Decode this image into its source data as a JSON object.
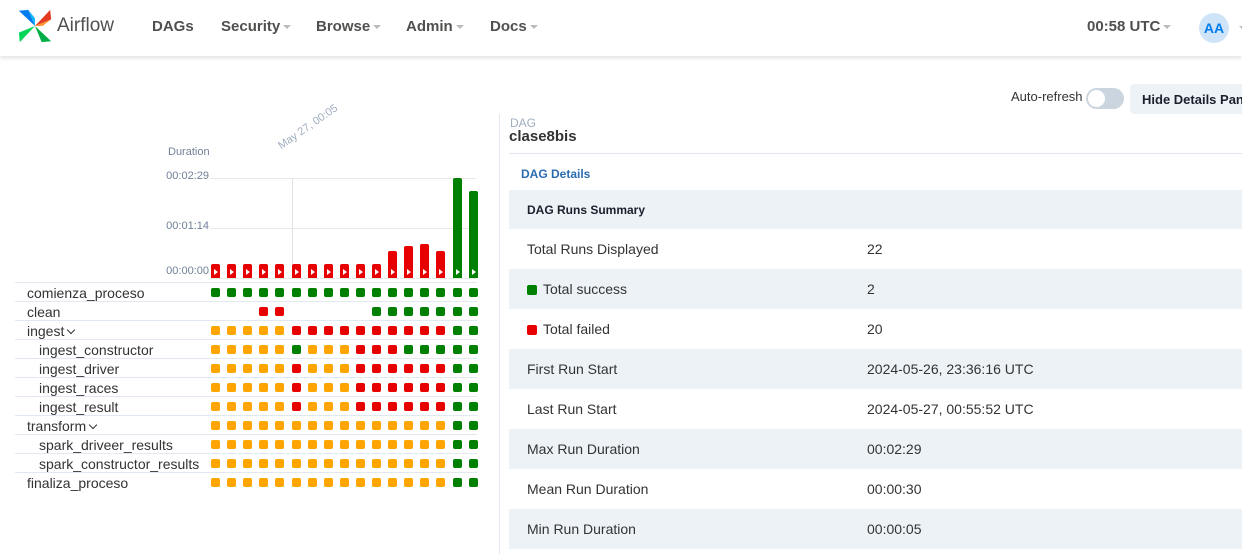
{
  "nav": {
    "brand": "Airflow",
    "items": [
      {
        "label": "DAGs",
        "dropdown": false
      },
      {
        "label": "Security",
        "dropdown": true
      },
      {
        "label": "Browse",
        "dropdown": true
      },
      {
        "label": "Admin",
        "dropdown": true
      },
      {
        "label": "Docs",
        "dropdown": true
      }
    ],
    "clock": "00:58 UTC",
    "avatar": "AA"
  },
  "toolbar": {
    "auto_refresh_label": "Auto-refresh",
    "auto_refresh_on": false,
    "hide_details_label": "Hide Details Panel"
  },
  "grid": {
    "duration_label": "Duration",
    "y_ticks": [
      "00:02:29",
      "00:01:14",
      "00:00:00"
    ],
    "date_marker": "May 27, 00:05",
    "runs": [
      {
        "state": "failed",
        "duration_s": 5
      },
      {
        "state": "failed",
        "duration_s": 5
      },
      {
        "state": "failed",
        "duration_s": 5
      },
      {
        "state": "failed",
        "duration_s": 5
      },
      {
        "state": "failed",
        "duration_s": 5
      },
      {
        "state": "failed",
        "duration_s": 5
      },
      {
        "state": "failed",
        "duration_s": 5
      },
      {
        "state": "failed",
        "duration_s": 5
      },
      {
        "state": "failed",
        "duration_s": 5
      },
      {
        "state": "failed",
        "duration_s": 11
      },
      {
        "state": "failed",
        "duration_s": 8
      },
      {
        "state": "failed",
        "duration_s": 40
      },
      {
        "state": "failed",
        "duration_s": 48
      },
      {
        "state": "failed",
        "duration_s": 51
      },
      {
        "state": "failed",
        "duration_s": 40
      },
      {
        "state": "success",
        "duration_s": 149
      },
      {
        "state": "success",
        "duration_s": 129
      }
    ],
    "tasks": [
      {
        "name": "comienza_proceso",
        "level": 0,
        "group": false,
        "states": "GGGGGGGGGGGGGGGGG"
      },
      {
        "name": "clean",
        "level": 0,
        "group": false,
        "states": "...RR.....GGGGGGG"
      },
      {
        "name": "ingest",
        "level": 0,
        "group": true,
        "states": "OOOOORRRRRRRRRRGG"
      },
      {
        "name": "ingest_constructor",
        "level": 1,
        "group": false,
        "states": "OOOOOGOOORRRGGGGG"
      },
      {
        "name": "ingest_driver",
        "level": 1,
        "group": false,
        "states": "OOOOOROOORRRRRRGG"
      },
      {
        "name": "ingest_races",
        "level": 1,
        "group": false,
        "states": "OOOOOROOORRRRRRGG"
      },
      {
        "name": "ingest_result",
        "level": 1,
        "group": false,
        "states": "OOOOOROOORRRRRRGG"
      },
      {
        "name": "transform",
        "level": 0,
        "group": true,
        "states": "OOOOOOOOOOOOOOOGG"
      },
      {
        "name": "spark_driveer_results",
        "level": 1,
        "group": false,
        "states": "OOOOOOOOOOOOOOOGG"
      },
      {
        "name": "spark_constructor_results",
        "level": 1,
        "group": false,
        "states": "OOOOOOOOOOOOOOOGG"
      },
      {
        "name": "finaliza_proceso",
        "level": 0,
        "group": false,
        "states": "OOOOOOOOOOOOOOOGG"
      }
    ]
  },
  "details": {
    "dag_label": "DAG",
    "dag_id": "clase8bis",
    "details_link": "DAG Details",
    "summary_title": "DAG Runs Summary",
    "rows": [
      {
        "key": "Total Runs Displayed",
        "value": "22",
        "legend": ""
      },
      {
        "key": "Total success",
        "value": "2",
        "legend": "success"
      },
      {
        "key": "Total failed",
        "value": "20",
        "legend": "failed"
      },
      {
        "key": "First Run Start",
        "value": "2024-05-26, 23:36:16 UTC",
        "legend": ""
      },
      {
        "key": "Last Run Start",
        "value": "2024-05-27, 00:55:52 UTC",
        "legend": ""
      },
      {
        "key": "Max Run Duration",
        "value": "00:02:29",
        "legend": ""
      },
      {
        "key": "Mean Run Duration",
        "value": "00:00:30",
        "legend": ""
      },
      {
        "key": "Min Run Duration",
        "value": "00:00:05",
        "legend": ""
      }
    ]
  },
  "colors": {
    "success": "#008000",
    "failed": "#e60000",
    "upstream_failed": "#ffa500",
    "brand_blue": "#017cee"
  }
}
